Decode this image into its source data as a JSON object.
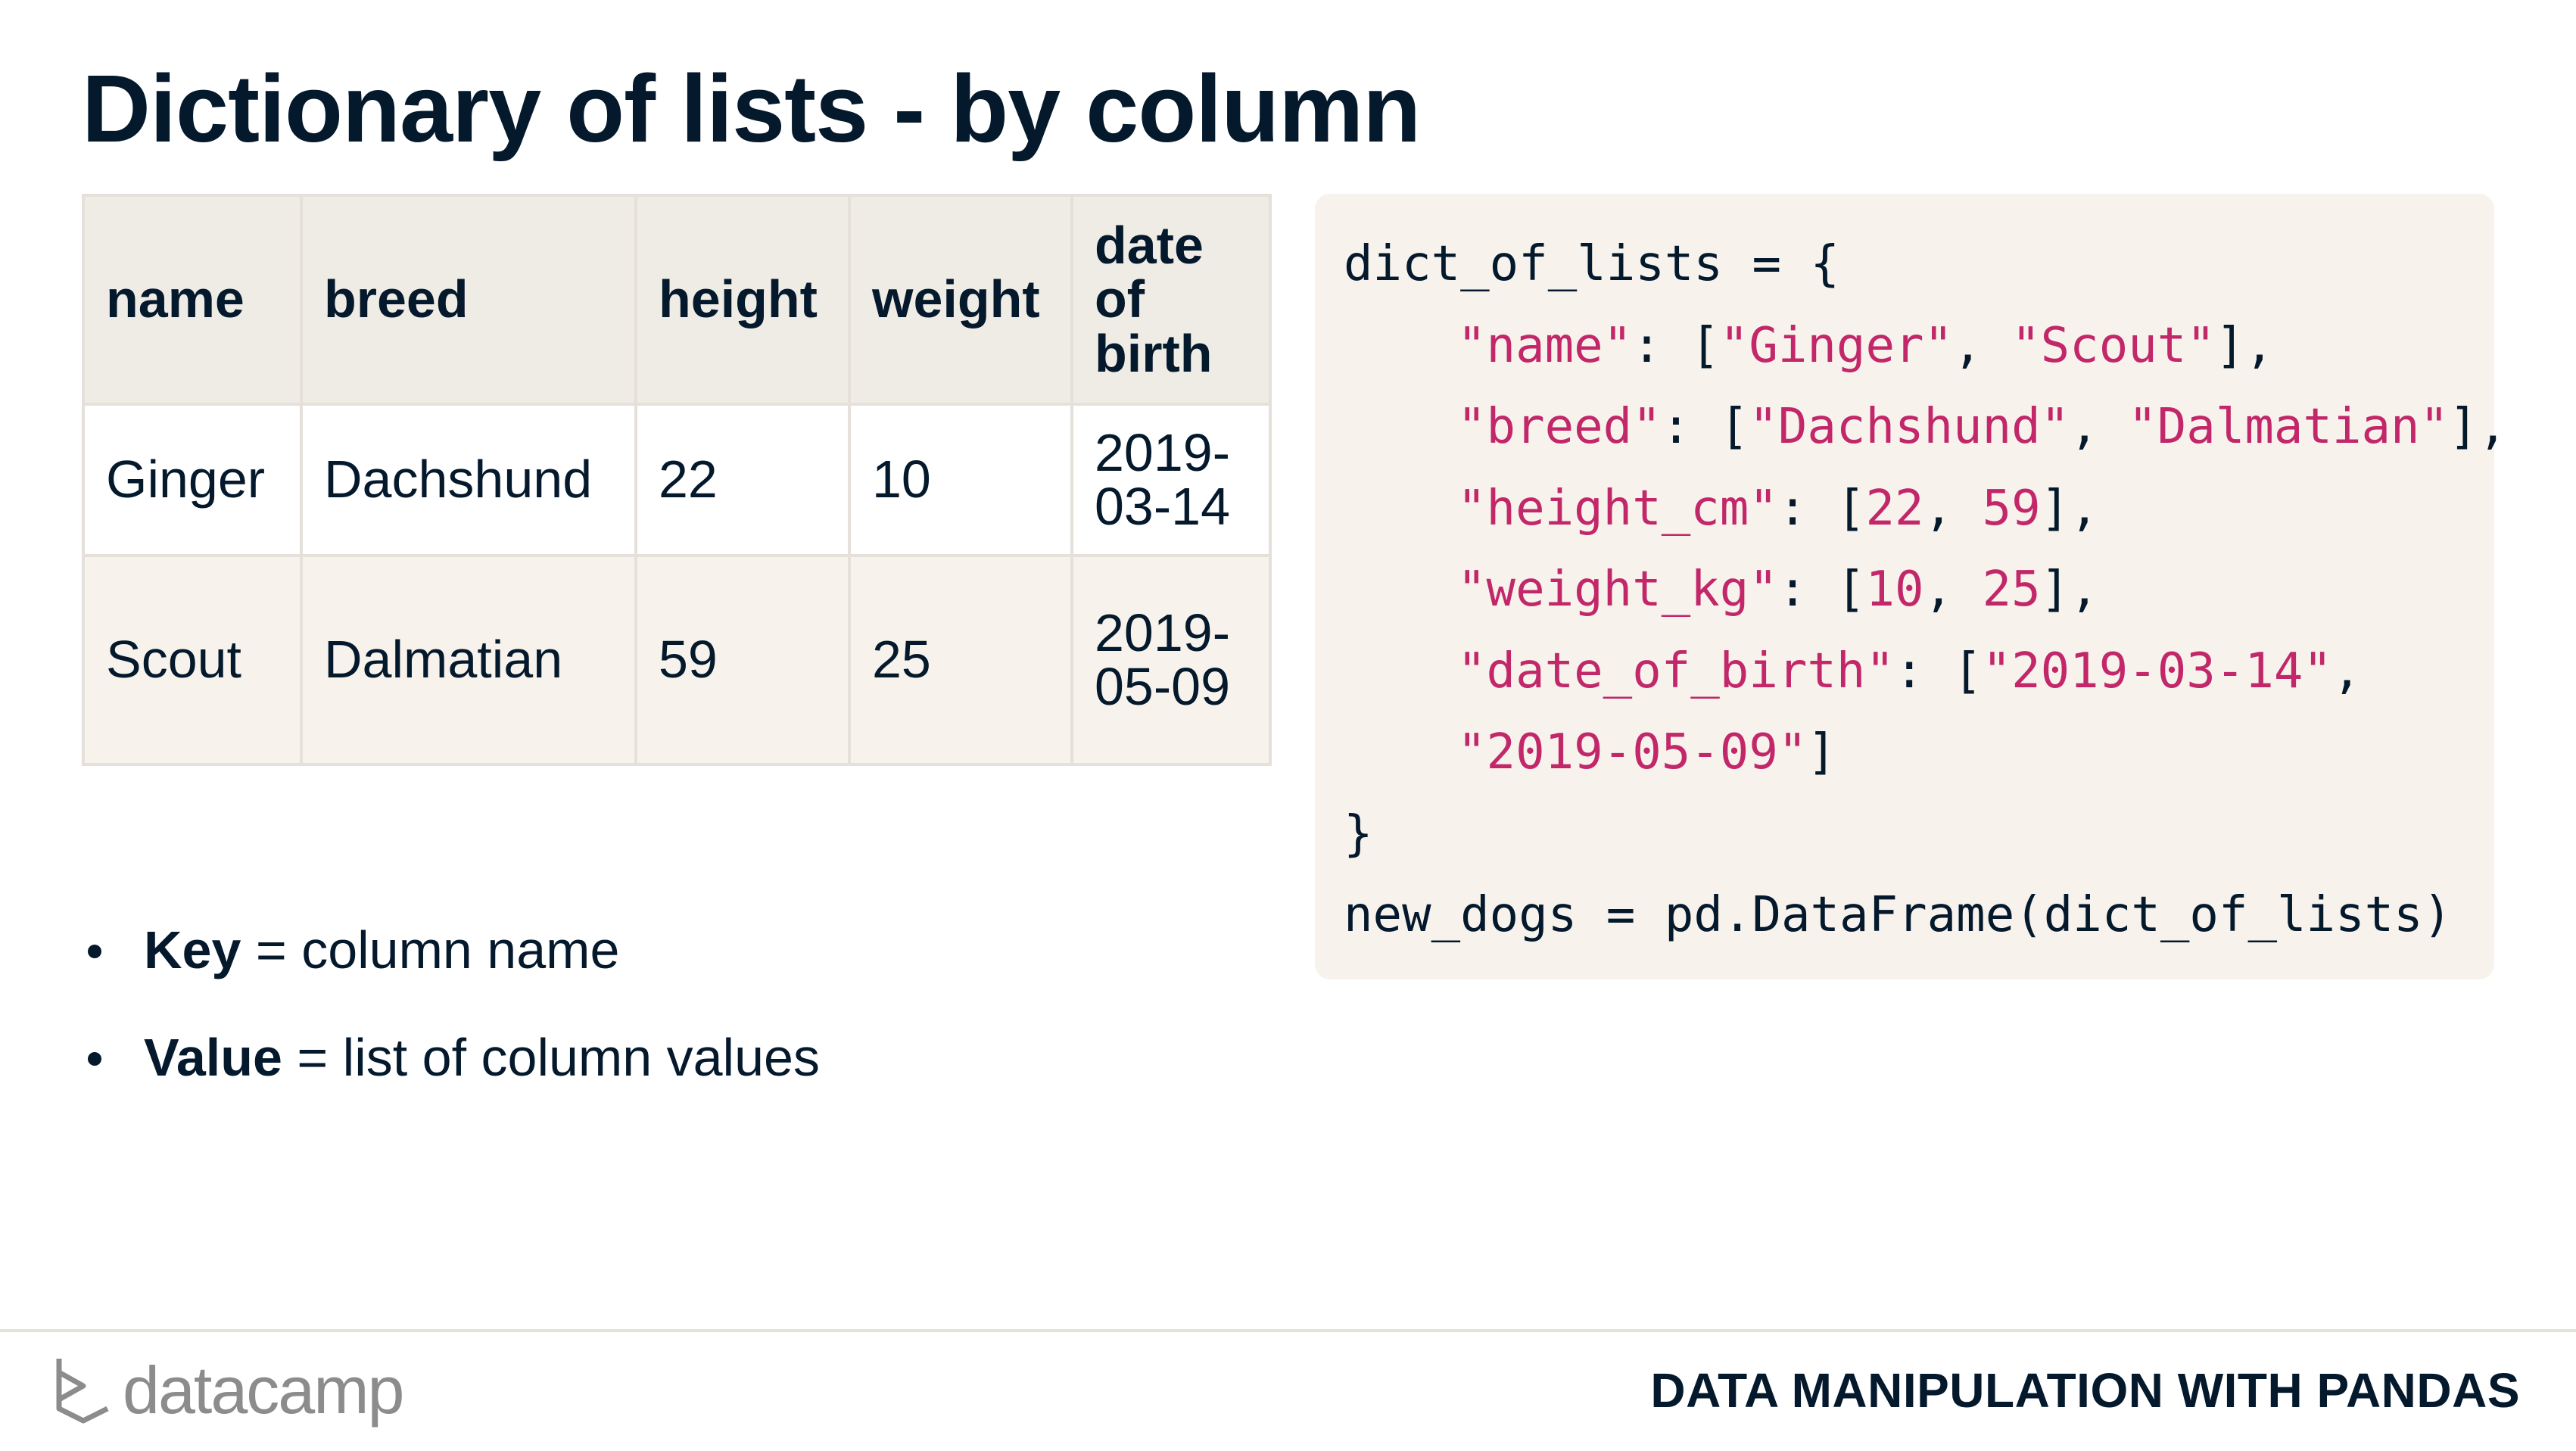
{
  "slide": {
    "title": "Dictionary of lists - by column"
  },
  "table": {
    "headers": [
      "name",
      "breed",
      "height",
      "weight",
      "date of birth"
    ],
    "rows": [
      [
        "Ginger",
        "Dachshund",
        "22",
        "10",
        "2019-03-14"
      ],
      [
        "Scout",
        "Dalmatian",
        "59",
        "25",
        "2019-05-09"
      ]
    ]
  },
  "bullets": [
    {
      "bold": "Key",
      "rest": " = column name"
    },
    {
      "bold": "Value",
      "rest": " = list of column values"
    }
  ],
  "code": {
    "l0": "dict_of_lists = {",
    "l1": {
      "k": "\"name\"",
      "p1": ": [",
      "v1": "\"Ginger\"",
      "sep": ", ",
      "v2": "\"Scout\"",
      "end": "],"
    },
    "l2": {
      "k": "\"breed\"",
      "p1": ": [",
      "v1": "\"Dachshund\"",
      "sep": ", ",
      "v2": "\"Dalmatian\"",
      "end": "],"
    },
    "l3": {
      "k": "\"height_cm\"",
      "p1": ": [",
      "v1": "22",
      "sep": ", ",
      "v2": "59",
      "end": "],"
    },
    "l4": {
      "k": "\"weight_kg\"",
      "p1": ": [",
      "v1": "10",
      "sep": ", ",
      "v2": "25",
      "end": "],"
    },
    "l5": {
      "k": "\"date_of_birth\"",
      "p1": ": [",
      "v1": "\"2019-03-14\"",
      "end": ","
    },
    "l6": {
      "v2": "\"2019-05-09\"",
      "end": "]"
    },
    "l7": "}",
    "l8": "new_dogs = pd.DataFrame(dict_of_lists)"
  },
  "footer": {
    "brand": "datacamp",
    "course": "DATA MANIPULATION WITH PANDAS"
  },
  "colors": {
    "ink": "#05192d",
    "string": "#c2276a",
    "code_bg": "#f7f3ec",
    "header_bg": "#efebe5"
  },
  "icons": {
    "logo": "datacamp-logo-icon"
  }
}
